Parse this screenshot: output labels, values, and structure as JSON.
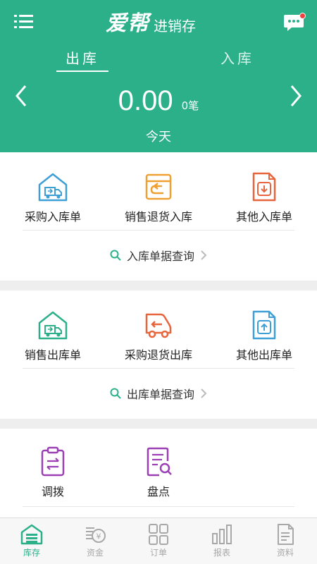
{
  "header": {
    "logo_main": "爱帮",
    "logo_sub": "进销存",
    "tabs": [
      {
        "label": "出库",
        "active": true
      },
      {
        "label": "入库",
        "active": false
      }
    ],
    "amount": "0.00",
    "amount_unit": "0笔",
    "date_label": "今天",
    "accent_color": "#2bb08a",
    "icons": {
      "menu": "menu-icon",
      "message": "message-icon",
      "prev": "chevron-left-icon",
      "next": "chevron-right-icon"
    }
  },
  "inbound": {
    "actions": [
      {
        "label": "采购入库单",
        "icon": "warehouse-truck-icon",
        "color": "#3d9fd6"
      },
      {
        "label": "销售退货入库",
        "icon": "return-box-icon",
        "color": "#f0a030"
      },
      {
        "label": "其他入库单",
        "icon": "document-download-icon",
        "color": "#e8643c"
      }
    ],
    "query_label": "入库单据查询"
  },
  "outbound": {
    "actions": [
      {
        "label": "销售出库单",
        "icon": "warehouse-truck-icon",
        "color": "#2bb08a"
      },
      {
        "label": "采购退货出库",
        "icon": "truck-return-icon",
        "color": "#e8643c"
      },
      {
        "label": "其他出库单",
        "icon": "document-upload-icon",
        "color": "#3d9fd6"
      }
    ],
    "query_label": "出库单据查询"
  },
  "misc": {
    "actions": [
      {
        "label": "调拨",
        "icon": "clipboard-transfer-icon",
        "color": "#9b3fb5"
      },
      {
        "label": "盘点",
        "icon": "document-search-icon",
        "color": "#9b3fb5"
      }
    ]
  },
  "tabbar": {
    "items": [
      {
        "label": "库存",
        "icon": "warehouse-icon",
        "active": true
      },
      {
        "label": "资金",
        "icon": "money-icon",
        "active": false
      },
      {
        "label": "订单",
        "icon": "grid-icon",
        "active": false
      },
      {
        "label": "报表",
        "icon": "bar-chart-icon",
        "active": false
      },
      {
        "label": "资料",
        "icon": "document-icon",
        "active": false
      }
    ]
  }
}
